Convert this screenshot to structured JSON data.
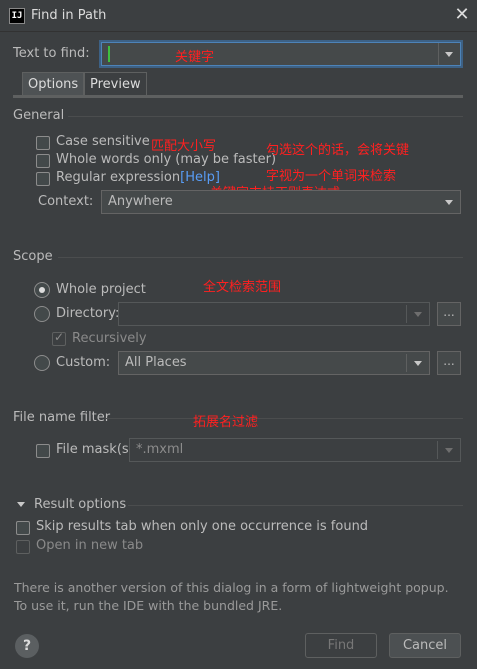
{
  "window": {
    "title": "Find in Path",
    "icon_text": "IJ"
  },
  "find": {
    "label": "Text to find:",
    "value": "",
    "annotation": "关键字"
  },
  "tabs": [
    {
      "label": "Options"
    },
    {
      "label": "Preview"
    }
  ],
  "general": {
    "title": "General",
    "case_sensitive": {
      "label": "Case sensitive",
      "checked": false
    },
    "whole_words": {
      "label": "Whole words only (may be faster)",
      "checked": false
    },
    "regex": {
      "label": "Regular expression",
      "help": "[Help]",
      "checked": false
    },
    "context": {
      "label": "Context:",
      "value": "Anywhere"
    },
    "annotations": {
      "case": "匹配大小写",
      "whole_words_1": "勾选这个的话，会将关键",
      "whole_words_2": "字视为一个单词来检索",
      "regex": "关键字支持正则表达式"
    }
  },
  "scope": {
    "title": "Scope",
    "whole_project": {
      "label": "Whole project",
      "selected": true
    },
    "directory": {
      "label": "Directory:",
      "value": "",
      "browse": "..."
    },
    "recursively": {
      "label": "Recursively",
      "checked": true
    },
    "custom": {
      "label": "Custom:",
      "value": "All Places",
      "browse": "..."
    },
    "annotation": "全文检索范围"
  },
  "file_filter": {
    "title": "File name filter",
    "mask": {
      "label": "File mask(s)",
      "value": "*.mxml",
      "checked": false
    },
    "annotation": "拓展名过滤"
  },
  "result_options": {
    "title": "Result options",
    "skip_tab": {
      "label": "Skip results tab when only one occurrence is found",
      "checked": false
    },
    "new_tab": {
      "label": "Open in new tab",
      "checked": false
    }
  },
  "notice": {
    "line1": "There is another version of this dialog in a form of lightweight popup.",
    "line2": "To use it, run the IDE with the bundled JRE."
  },
  "buttons": {
    "help": "?",
    "find": "Find",
    "cancel": "Cancel"
  },
  "colors": {
    "background": "#3c3f41",
    "annotation": "#ff2020",
    "link": "#589df6",
    "focus": "#4d83b8"
  }
}
